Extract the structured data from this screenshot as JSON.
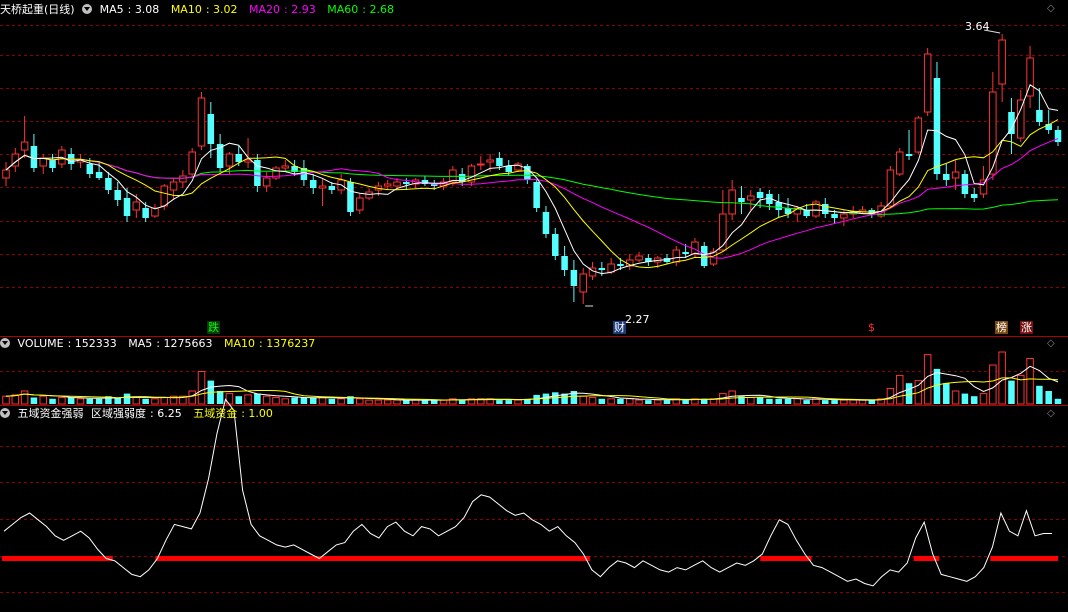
{
  "main_panel": {
    "title": "天桥起重(日线)",
    "indicators": [
      {
        "label": "MA5",
        "value": "3.08",
        "color": "#ffffff"
      },
      {
        "label": "MA10",
        "value": "3.02",
        "color": "#ffff00"
      },
      {
        "label": "MA20",
        "value": "2.93",
        "color": "#ff00ff"
      },
      {
        "label": "MA60",
        "value": "2.68",
        "color": "#00ff00"
      }
    ],
    "high_label": "3.64",
    "low_label": "2.27",
    "tags": [
      {
        "text": "跌",
        "color": "#00ff00",
        "bg": "#0a3a0a"
      },
      {
        "text": "财",
        "color": "#ffffff",
        "bg": "#1a3a7a"
      },
      {
        "text": "$",
        "color": "#ff3030",
        "bg": "#000000"
      },
      {
        "text": "榜",
        "color": "#ffffff",
        "bg": "#7a4a10"
      },
      {
        "text": "涨",
        "color": "#ffffff",
        "bg": "#7a1010"
      }
    ]
  },
  "volume_panel": {
    "title": "VOLUME",
    "value": "152333",
    "ma5_label": "MA5",
    "ma5_value": "1275663",
    "ma10_label": "MA10",
    "ma10_value": "1376237"
  },
  "indicator_panel": {
    "title": "五域资金强弱",
    "line1_label": "区域强弱度",
    "line1_value": "6.25",
    "line2_label": "五域资金",
    "line2_value": "1.00"
  },
  "colors": {
    "up": "#ff3232",
    "down": "#54ffff",
    "grid": "#8b0000",
    "ma5": "#ffffff",
    "ma10": "#ffff00",
    "ma20": "#ff00ff",
    "ma60": "#00ff00"
  },
  "chart_data": {
    "type": "candlestick",
    "ohlc": [
      [
        2.9,
        2.98,
        2.86,
        2.94
      ],
      [
        2.96,
        3.05,
        2.93,
        3.02
      ],
      [
        3.04,
        3.21,
        3.0,
        3.08
      ],
      [
        3.06,
        3.12,
        2.93,
        2.95
      ],
      [
        2.96,
        3.02,
        2.92,
        3.0
      ],
      [
        2.99,
        3.02,
        2.93,
        2.95
      ],
      [
        2.97,
        3.06,
        2.95,
        3.04
      ],
      [
        3.02,
        3.05,
        2.94,
        2.97
      ],
      [
        2.98,
        3.02,
        2.95,
        2.99
      ],
      [
        2.97,
        3.0,
        2.9,
        2.92
      ],
      [
        2.93,
        2.98,
        2.89,
        2.9
      ],
      [
        2.9,
        2.93,
        2.82,
        2.84
      ],
      [
        2.84,
        2.88,
        2.76,
        2.79
      ],
      [
        2.8,
        2.85,
        2.68,
        2.71
      ],
      [
        2.74,
        2.82,
        2.7,
        2.78
      ],
      [
        2.75,
        2.78,
        2.68,
        2.7
      ],
      [
        2.71,
        2.77,
        2.7,
        2.75
      ],
      [
        2.76,
        2.87,
        2.74,
        2.86
      ],
      [
        2.84,
        2.9,
        2.79,
        2.88
      ],
      [
        2.88,
        2.94,
        2.85,
        2.91
      ],
      [
        2.92,
        3.05,
        2.9,
        3.03
      ],
      [
        3.06,
        3.33,
        3.04,
        3.3
      ],
      [
        3.22,
        3.28,
        3.0,
        3.07
      ],
      [
        3.07,
        3.12,
        2.93,
        2.95
      ],
      [
        2.96,
        3.03,
        2.92,
        3.02
      ],
      [
        3.02,
        3.06,
        2.96,
        2.98
      ],
      [
        2.98,
        3.1,
        2.95,
        2.99
      ],
      [
        2.99,
        3.02,
        2.83,
        2.86
      ],
      [
        2.86,
        2.93,
        2.83,
        2.9
      ],
      [
        2.9,
        2.96,
        2.89,
        2.95
      ],
      [
        2.95,
        2.99,
        2.93,
        2.96
      ],
      [
        2.96,
        2.99,
        2.91,
        2.93
      ],
      [
        2.95,
        2.99,
        2.86,
        2.89
      ],
      [
        2.89,
        2.92,
        2.82,
        2.85
      ],
      [
        2.85,
        2.9,
        2.76,
        2.86
      ],
      [
        2.86,
        2.88,
        2.82,
        2.84
      ],
      [
        2.84,
        2.92,
        2.82,
        2.89
      ],
      [
        2.88,
        2.9,
        2.71,
        2.73
      ],
      [
        2.74,
        2.82,
        2.72,
        2.8
      ],
      [
        2.8,
        2.85,
        2.79,
        2.83
      ],
      [
        2.84,
        2.88,
        2.81,
        2.86
      ],
      [
        2.86,
        2.89,
        2.84,
        2.87
      ],
      [
        2.86,
        2.9,
        2.85,
        2.88
      ],
      [
        2.88,
        2.9,
        2.84,
        2.87
      ],
      [
        2.87,
        2.9,
        2.85,
        2.89
      ],
      [
        2.89,
        2.91,
        2.86,
        2.87
      ],
      [
        2.87,
        2.89,
        2.84,
        2.86
      ],
      [
        2.86,
        2.9,
        2.84,
        2.88
      ],
      [
        2.88,
        2.96,
        2.86,
        2.94
      ],
      [
        2.92,
        2.95,
        2.86,
        2.88
      ],
      [
        2.88,
        2.97,
        2.86,
        2.96
      ],
      [
        2.97,
        3.01,
        2.94,
        2.97
      ],
      [
        2.98,
        3.02,
        2.93,
        2.99
      ],
      [
        3.0,
        3.03,
        2.94,
        2.96
      ],
      [
        2.96,
        2.99,
        2.91,
        2.93
      ],
      [
        2.94,
        2.98,
        2.93,
        2.97
      ],
      [
        2.96,
        2.97,
        2.87,
        2.89
      ],
      [
        2.88,
        2.89,
        2.73,
        2.75
      ],
      [
        2.73,
        2.76,
        2.6,
        2.62
      ],
      [
        2.62,
        2.65,
        2.49,
        2.51
      ],
      [
        2.51,
        2.56,
        2.41,
        2.44
      ],
      [
        2.44,
        2.49,
        2.28,
        2.36
      ],
      [
        2.33,
        2.45,
        2.27,
        2.42
      ],
      [
        2.41,
        2.48,
        2.39,
        2.45
      ],
      [
        2.45,
        2.48,
        2.41,
        2.44
      ],
      [
        2.43,
        2.5,
        2.42,
        2.47
      ],
      [
        2.47,
        2.5,
        2.44,
        2.46
      ],
      [
        2.46,
        2.52,
        2.44,
        2.49
      ],
      [
        2.49,
        2.53,
        2.48,
        2.51
      ],
      [
        2.5,
        2.52,
        2.46,
        2.48
      ],
      [
        2.48,
        2.51,
        2.45,
        2.5
      ],
      [
        2.5,
        2.52,
        2.47,
        2.48
      ],
      [
        2.48,
        2.56,
        2.46,
        2.54
      ],
      [
        2.53,
        2.57,
        2.5,
        2.52
      ],
      [
        2.52,
        2.6,
        2.5,
        2.58
      ],
      [
        2.56,
        2.58,
        2.45,
        2.46
      ],
      [
        2.47,
        2.55,
        2.46,
        2.53
      ],
      [
        2.54,
        2.84,
        2.53,
        2.72
      ],
      [
        2.72,
        2.89,
        2.69,
        2.84
      ],
      [
        2.8,
        2.86,
        2.72,
        2.78
      ],
      [
        2.79,
        2.84,
        2.74,
        2.81
      ],
      [
        2.83,
        2.85,
        2.75,
        2.8
      ],
      [
        2.82,
        2.84,
        2.74,
        2.77
      ],
      [
        2.78,
        2.82,
        2.7,
        2.74
      ],
      [
        2.75,
        2.8,
        2.7,
        2.72
      ],
      [
        2.72,
        2.76,
        2.68,
        2.75
      ],
      [
        2.74,
        2.77,
        2.7,
        2.71
      ],
      [
        2.71,
        2.79,
        2.7,
        2.78
      ],
      [
        2.77,
        2.8,
        2.7,
        2.72
      ],
      [
        2.72,
        2.74,
        2.67,
        2.7
      ],
      [
        2.7,
        2.74,
        2.66,
        2.72
      ],
      [
        2.72,
        2.76,
        2.7,
        2.73
      ],
      [
        2.73,
        2.76,
        2.72,
        2.74
      ],
      [
        2.74,
        2.75,
        2.7,
        2.72
      ],
      [
        2.71,
        2.78,
        2.7,
        2.76
      ],
      [
        2.76,
        2.96,
        2.75,
        2.94
      ],
      [
        2.92,
        3.05,
        2.91,
        3.03
      ],
      [
        3.02,
        3.14,
        2.99,
        3.01
      ],
      [
        3.03,
        3.21,
        3.02,
        3.2
      ],
      [
        3.23,
        3.55,
        3.21,
        3.52
      ],
      [
        3.4,
        3.48,
        2.89,
        2.92
      ],
      [
        2.92,
        2.97,
        2.86,
        2.89
      ],
      [
        2.9,
        2.99,
        2.84,
        2.93
      ],
      [
        2.92,
        2.94,
        2.8,
        2.82
      ],
      [
        2.82,
        2.85,
        2.78,
        2.8
      ],
      [
        2.82,
        2.96,
        2.8,
        2.89
      ],
      [
        2.92,
        3.43,
        2.89,
        3.33
      ],
      [
        3.37,
        3.62,
        3.28,
        3.59
      ],
      [
        3.23,
        3.3,
        3.02,
        3.12
      ],
      [
        3.1,
        3.34,
        3.08,
        3.29
      ],
      [
        3.31,
        3.56,
        3.25,
        3.5
      ],
      [
        3.24,
        3.35,
        3.16,
        3.18
      ],
      [
        3.17,
        3.24,
        3.12,
        3.14
      ],
      [
        3.14,
        3.16,
        3.06,
        3.08
      ]
    ],
    "volume": [
      6,
      7,
      10,
      5,
      6,
      4,
      5,
      5,
      4,
      4,
      4,
      6,
      5,
      8,
      5,
      4,
      4,
      5,
      6,
      6,
      10,
      25,
      18,
      10,
      8,
      6,
      7,
      8,
      6,
      5,
      4,
      5,
      5,
      5,
      5,
      4,
      4,
      6,
      4,
      3,
      3,
      3,
      3,
      3,
      3,
      3,
      3,
      3,
      4,
      3,
      4,
      4,
      4,
      3,
      3,
      3,
      4,
      7,
      8,
      9,
      8,
      10,
      6,
      5,
      4,
      4,
      4,
      4,
      3,
      3,
      3,
      3,
      4,
      3,
      4,
      4,
      4,
      8,
      10,
      6,
      5,
      5,
      4,
      4,
      4,
      4,
      3,
      4,
      3,
      3,
      3,
      3,
      3,
      3,
      4,
      12,
      22,
      16,
      18,
      38,
      27,
      16,
      10,
      8,
      6,
      8,
      30,
      40,
      18,
      22,
      35,
      14,
      10,
      4
    ],
    "volume_ylim": [
      0,
      40
    ],
    "indicator_line": [
      3.2,
      3.5,
      3.8,
      4.0,
      3.7,
      3.4,
      3.0,
      2.8,
      3.0,
      3.2,
      2.9,
      2.4,
      2.0,
      1.9,
      1.6,
      1.3,
      1.2,
      1.5,
      2.0,
      2.8,
      3.5,
      3.4,
      3.3,
      4.0,
      5.5,
      7.5,
      9.0,
      8.5,
      5.0,
      3.5,
      3.0,
      2.8,
      2.6,
      2.5,
      2.6,
      2.4,
      2.2,
      2.0,
      2.3,
      2.6,
      2.7,
      3.2,
      3.5,
      3.1,
      2.9,
      3.4,
      3.6,
      3.2,
      3.0,
      3.4,
      3.3,
      3.0,
      3.2,
      3.4,
      3.8,
      4.5,
      4.8,
      4.7,
      4.4,
      4.1,
      3.9,
      4.0,
      3.7,
      3.5,
      3.2,
      3.4,
      3.0,
      2.7,
      2.2,
      1.5,
      1.2,
      1.6,
      1.9,
      1.8,
      1.6,
      1.9,
      1.7,
      1.5,
      1.4,
      1.6,
      1.5,
      1.7,
      1.9,
      1.6,
      1.4,
      1.6,
      1.8,
      1.7,
      1.9,
      2.2,
      3.0,
      3.7,
      3.5,
      2.8,
      2.2,
      1.7,
      1.6,
      1.4,
      1.2,
      1.0,
      1.1,
      0.9,
      0.8,
      1.2,
      1.5,
      1.4,
      1.8,
      2.9,
      3.6,
      2.2,
      1.3,
      1.2,
      1.1,
      1.0,
      1.2,
      1.6,
      2.5,
      4.0,
      3.2,
      3.0,
      4.1,
      3.0,
      3.1,
      3.1
    ],
    "indicator_baseline": 1.0,
    "indicator_ylim": [
      0,
      8
    ],
    "ylim": [
      2.2,
      3.7
    ]
  }
}
